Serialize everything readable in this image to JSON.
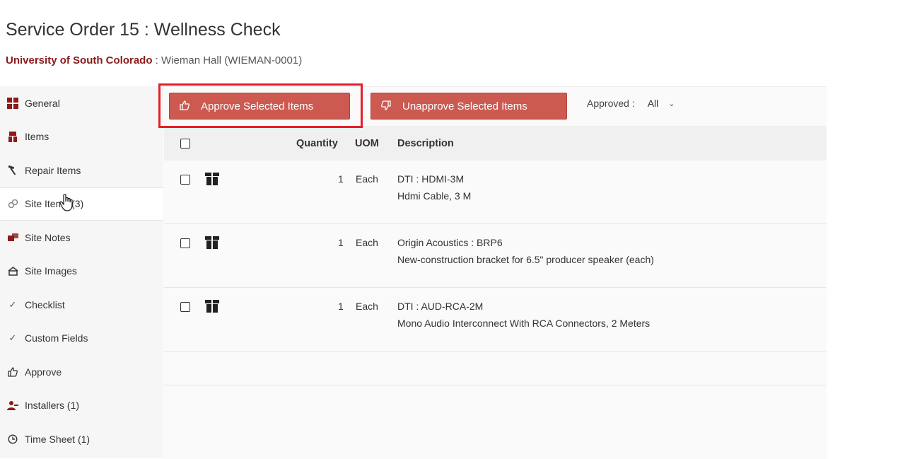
{
  "header": {
    "title": "Service Order 15 : Wellness Check",
    "organization": "University of South Colorado",
    "separator": " : ",
    "site": "Wieman Hall (WIEMAN-0001)"
  },
  "sidebar": {
    "items": [
      {
        "label": "General",
        "icon": "grid-icon"
      },
      {
        "label": "Items",
        "icon": "box-icon"
      },
      {
        "label": "Repair Items",
        "icon": "hammer-icon"
      },
      {
        "label": "Site Items (3)",
        "icon": "link-icon",
        "active": true
      },
      {
        "label": "Site Notes",
        "icon": "note-icon"
      },
      {
        "label": "Site Images",
        "icon": "image-icon"
      },
      {
        "label": "Checklist",
        "icon": "check-icon"
      },
      {
        "label": "Custom Fields",
        "icon": "check-icon"
      },
      {
        "label": "Approve",
        "icon": "thumbs-up-icon"
      },
      {
        "label": "Installers (1)",
        "icon": "installer-icon"
      },
      {
        "label": "Time Sheet (1)",
        "icon": "clock-icon"
      }
    ]
  },
  "toolbar": {
    "approve_label": "Approve Selected Items",
    "unapprove_label": "Unapprove Selected Items",
    "filter_label": "Approved :",
    "filter_value": "All"
  },
  "table": {
    "columns": {
      "quantity": "Quantity",
      "uom": "UOM",
      "description": "Description"
    },
    "rows": [
      {
        "quantity": "1",
        "uom": "Each",
        "item": "DTI : HDMI-3M",
        "description": "Hdmi Cable, 3 M"
      },
      {
        "quantity": "1",
        "uom": "Each",
        "item": "Origin Acoustics : BRP6",
        "description": "New-construction bracket for 6.5\" producer speaker (each)"
      },
      {
        "quantity": "1",
        "uom": "Each",
        "item": "DTI : AUD-RCA-2M",
        "description": "Mono Audio Interconnect With RCA Connectors, 2 Meters"
      }
    ]
  },
  "colors": {
    "accent_button": "#cc5a50",
    "organization_text": "#8b1a1a",
    "highlight_box": "#e3202a"
  }
}
